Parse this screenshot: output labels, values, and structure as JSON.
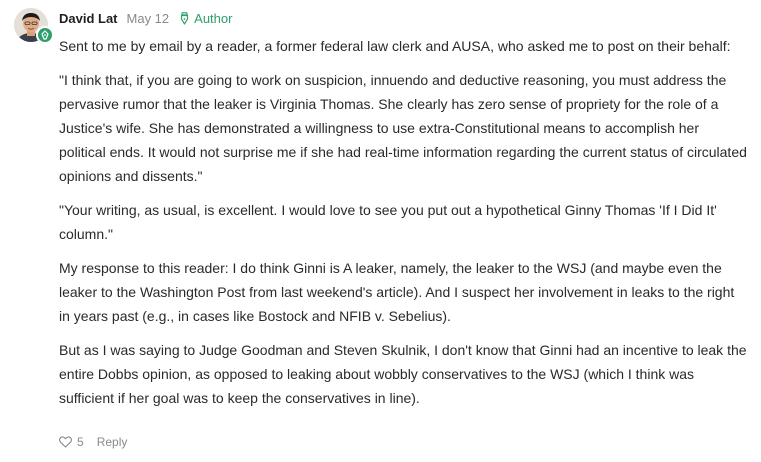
{
  "comment": {
    "author": "David Lat",
    "date": "May 12",
    "author_badge": "Author",
    "badge_color": "#2e9e6b",
    "avatar_icon": "avatar-photo",
    "paragraphs": [
      "Sent to me by email by a reader, a former federal law clerk and AUSA, who asked me to post on their behalf:",
      "\"I think that, if you are going to work on suspicion, innuendo and deductive reasoning, you must address the pervasive rumor that the leaker is Virginia Thomas. She clearly has zero sense of propriety for the role of a Justice's wife. She has demonstrated a willingness to use extra-Constitutional means to accomplish her political ends. It would not surprise me if she had real-time information regarding the current status of circulated opinions and dissents.\"",
      "\"Your writing, as usual, is excellent. I would love to see you put out a hypothetical Ginny Thomas 'If I Did It' column.\"",
      "My response to this reader: I do think Ginni is A leaker, namely, the leaker to the WSJ (and maybe even the leaker to the Washington Post from last weekend's article). And I suspect her involvement in leaks to the right in years past (e.g., in cases like Bostock and NFIB v. Sebelius).",
      "But as I was saying to Judge Goodman and Steven Skulnik, I don't know that Ginni had an incentive to leak the entire Dobbs opinion, as opposed to leaking about wobbly conservatives to the WSJ (which I think was sufficient if her goal was to keep the conservatives in line)."
    ],
    "like_count": "5",
    "reply_label": "Reply"
  }
}
